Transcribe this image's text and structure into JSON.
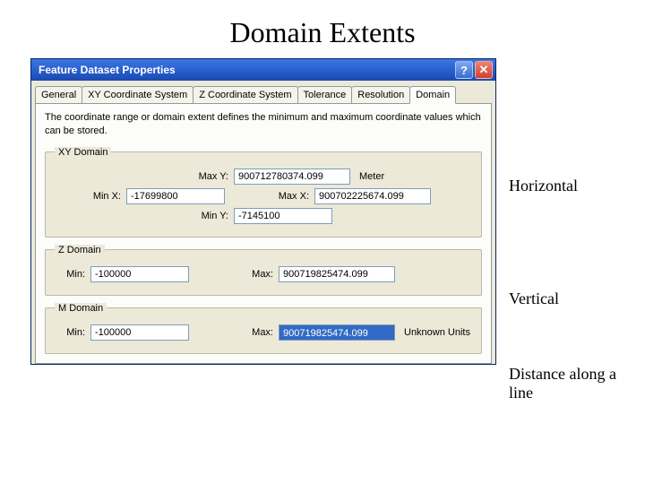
{
  "slide": {
    "title": "Domain Extents"
  },
  "window": {
    "title": "Feature Dataset Properties",
    "tabs": [
      "General",
      "XY Coordinate System",
      "Z Coordinate System",
      "Tolerance",
      "Resolution",
      "Domain"
    ],
    "active_tab": 5,
    "description": "The coordinate range or domain extent defines the minimum and maximum coordinate values which can be stored."
  },
  "groups": {
    "xy": {
      "legend": "XY Domain",
      "maxy_label": "Max Y:",
      "maxy_value": "900712780374.099",
      "unit": "Meter",
      "minx_label": "Min X:",
      "minx_value": "-17699800",
      "maxx_label": "Max X:",
      "maxx_value": "900702225674.099",
      "miny_label": "Min Y:",
      "miny_value": "-7145100"
    },
    "z": {
      "legend": "Z Domain",
      "min_label": "Min:",
      "min_value": "-100000",
      "max_label": "Max:",
      "max_value": "900719825474.099"
    },
    "m": {
      "legend": "M Domain",
      "min_label": "Min:",
      "min_value": "-100000",
      "max_label": "Max:",
      "max_value": "900719825474.099",
      "unit": "Unknown Units"
    }
  },
  "annotations": {
    "horizontal": "Horizontal",
    "vertical": "Vertical",
    "distance": "Distance along a line"
  }
}
